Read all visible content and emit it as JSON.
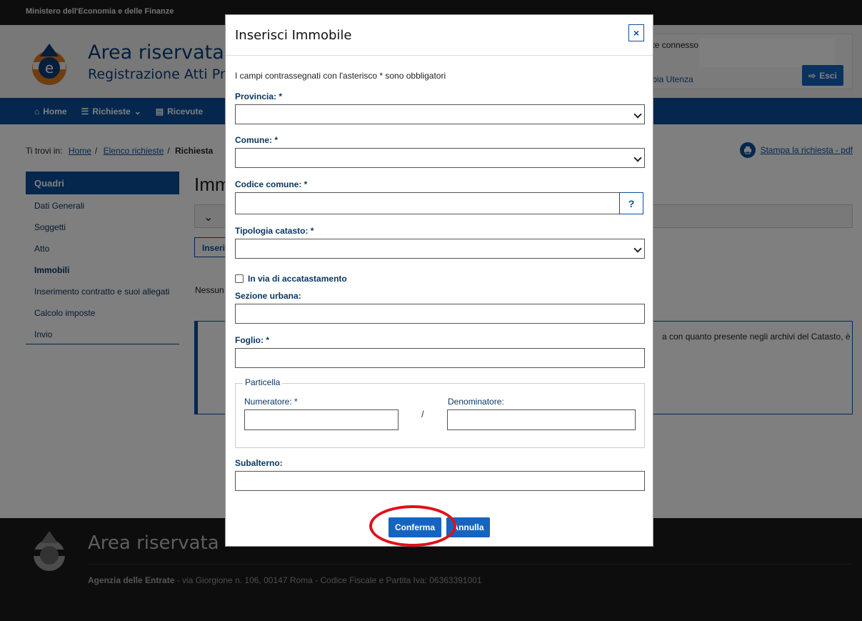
{
  "topbar": {
    "ministry": "Ministero dell'Economia e delle Finanze"
  },
  "header": {
    "title": "Area riservata",
    "subtitle": "Registrazione Atti Privati",
    "user_label": "Utente connesso:",
    "change_user": "Cambia Utenza",
    "logout": "Esci"
  },
  "nav": {
    "home": "Home",
    "requests": "Richieste",
    "receipts": "Ricevute"
  },
  "breadcrumb": {
    "prefix": "Ti trovi in:",
    "home": "Home",
    "list": "Elenco richieste",
    "current": "Richiesta"
  },
  "print_link": "Stampa la richiesta - pdf",
  "sidebar": {
    "title": "Quadri",
    "items": [
      {
        "label": "Dati Generali"
      },
      {
        "label": "Soggetti"
      },
      {
        "label": "Atto"
      },
      {
        "label": "Immobili"
      },
      {
        "label": "Inserimento contratto e suoi allegati"
      },
      {
        "label": "Calcolo imposte"
      },
      {
        "label": "Invio"
      }
    ]
  },
  "main": {
    "title": "Immobili",
    "insert_button": "Inserisci",
    "empty_text": "Nessun",
    "info_text": "a con quanto presente negli archivi del Catasto, è"
  },
  "footer": {
    "title": "Area riservata",
    "agency": "Agenzia delle Entrate",
    "address": " - via Giorgione n. 106, 00147 Roma - Codice Fiscale e Partita Iva: 06363391001"
  },
  "modal": {
    "title": "Inserisci Immobile",
    "close": "×",
    "note": "I campi contrassegnati con l'asterisco * sono obbligatori",
    "provincia_label": "Provincia: *",
    "comune_label": "Comune: *",
    "codice_comune_label": "Codice comune: *",
    "help": "?",
    "tipologia_label": "Tipologia catasto: *",
    "accatastamento_label": "In via di accatastamento",
    "sezione_label": "Sezione urbana:",
    "foglio_label": "Foglio: *",
    "particella_legend": "Particella",
    "numeratore_label": "Numeratore: *",
    "slash": "/",
    "denominatore_label": "Denominatore:",
    "subalterno_label": "Subalterno:",
    "confirm": "Conferma",
    "cancel": "Annulla"
  },
  "colors": {
    "primary": "#0b4f9c",
    "button": "#1565c0",
    "highlight": "#e0101a"
  }
}
